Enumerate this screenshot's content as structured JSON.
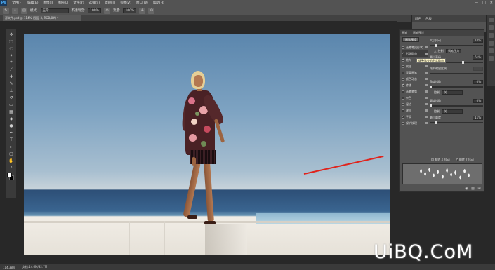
{
  "app": {
    "logo": "Ps",
    "menu": [
      "文件(F)",
      "编辑(E)",
      "图像(I)",
      "图层(L)",
      "文字(Y)",
      "选择(S)",
      "滤镜(T)",
      "视图(V)",
      "窗口(W)",
      "帮助(H)"
    ],
    "window_controls": [
      "—",
      "□",
      "✕"
    ]
  },
  "options_bar": {
    "mode_label": "模式:",
    "mode_value": "正常",
    "opacity_label": "不透明度:",
    "opacity_value": "100%",
    "flow_label": "流量:",
    "flow_value": "100%"
  },
  "document": {
    "tab_title": "源文件.psd @ 114% (图层 3, RGB/8#) *"
  },
  "panels": {
    "top_tabs": [
      "颜色",
      "色板"
    ],
    "brush": {
      "tabs": [
        "画笔",
        "画笔预设"
      ],
      "presets_button": "画笔预设",
      "list": [
        {
          "label": "画笔笔尖形状",
          "checked": false,
          "active": false
        },
        {
          "label": "形状动态",
          "checked": true,
          "active": true
        },
        {
          "label": "散布",
          "checked": true,
          "active": false
        },
        {
          "label": "纹理",
          "checked": false,
          "active": false
        },
        {
          "label": "双重画笔",
          "checked": false,
          "active": false
        },
        {
          "label": "颜色动态",
          "checked": false,
          "active": false
        },
        {
          "label": "传递",
          "checked": true,
          "active": false
        },
        {
          "label": "画笔笔势",
          "checked": false,
          "active": false
        },
        {
          "label": "杂色",
          "checked": false,
          "active": false
        },
        {
          "label": "湿边",
          "checked": false,
          "active": false
        },
        {
          "label": "建立",
          "checked": false,
          "active": false
        },
        {
          "label": "平滑",
          "checked": true,
          "active": false
        },
        {
          "label": "保护纹理",
          "checked": false,
          "active": false
        }
      ],
      "size_jitter_label": "大小抖动",
      "size_jitter_value": "10%",
      "size_jitter_fraction": 0.1,
      "control_label": "控制:",
      "control_value": "钢笔压力",
      "min_diameter_label": "最小直径",
      "min_diameter_value": "61%",
      "min_diameter_fraction": 0.61,
      "tooltip": "调整笔尖的形状动态",
      "tilt_scale_label": "倾斜缩放比例",
      "angle_jitter_label": "角度抖动",
      "angle_jitter_value": "0%",
      "angle_control_value": "关",
      "roundness_jitter_label": "圆度抖动",
      "roundness_jitter_value": "0%",
      "roundness_control_value": "关",
      "min_roundness_label": "最小圆度",
      "min_roundness_value": "11%",
      "min_roundness_fraction": 0.11,
      "flip_x_label": "翻转 X 抖动",
      "flip_y_label": "翻转 Y 抖动",
      "brush_projection_label": "画笔投影",
      "footer_icons": [
        "eye-icon",
        "grid-icon",
        "new-icon"
      ]
    }
  },
  "status": {
    "zoom": "114.38%",
    "doc_info": "文档:14.6M/32.7M"
  },
  "watermark": "UiBQ.CoM",
  "colors": {
    "accent_arrow": "#e0231c",
    "foreground": "#ffffff",
    "background": "#000000"
  }
}
